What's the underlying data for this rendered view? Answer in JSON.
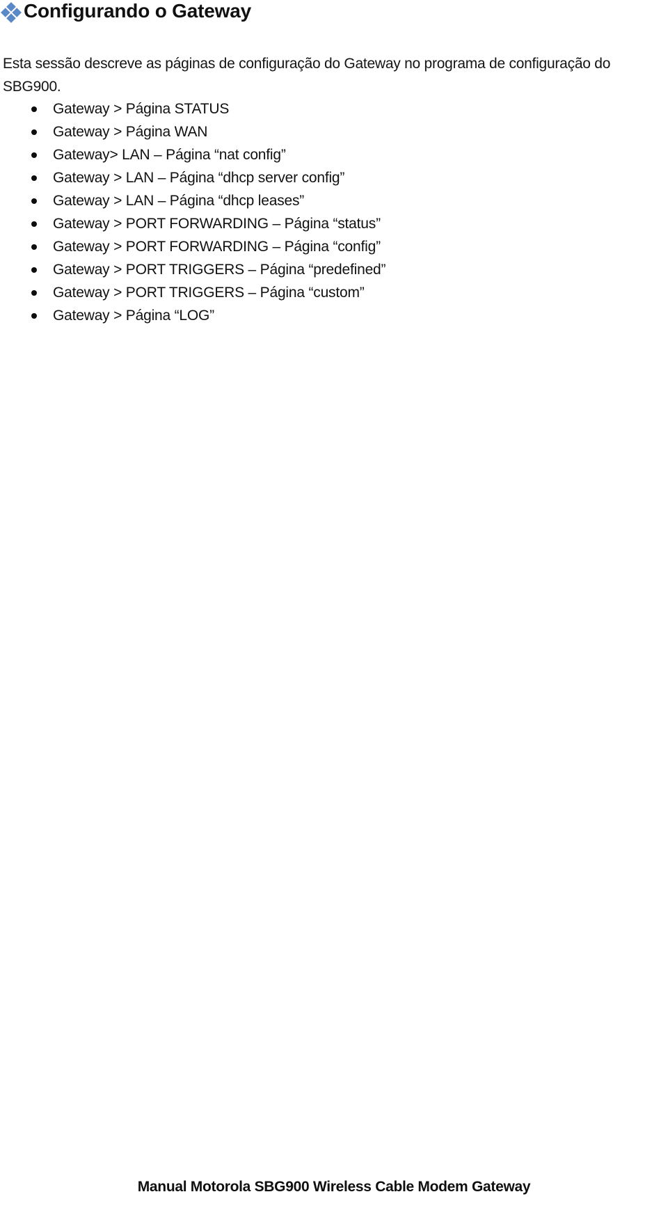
{
  "document": {
    "heading": {
      "bullet_icon": "diamond-cluster-icon",
      "bullet_color": "#5b89c7",
      "text": "Configurando o Gateway"
    },
    "intro_paragraph": "Esta sessão descreve as páginas de configuração do Gateway no programa de configuração do SBG900.",
    "list": {
      "bullet_icon": "round-bullet-icon",
      "items": [
        "Gateway > Página STATUS",
        "Gateway > Página WAN",
        "Gateway> LAN – Página “nat config”",
        "Gateway > LAN – Página “dhcp server config”",
        "Gateway > LAN – Página “dhcp leases”",
        "Gateway > PORT FORWARDING – Página “status”",
        "Gateway > PORT FORWARDING – Página “config”",
        "Gateway > PORT TRIGGERS – Página “predefined”",
        "Gateway > PORT TRIGGERS – Página “custom”",
        "Gateway > Página “LOG”"
      ]
    },
    "footer": "Manual Motorola SBG900 Wireless Cable Modem Gateway"
  }
}
